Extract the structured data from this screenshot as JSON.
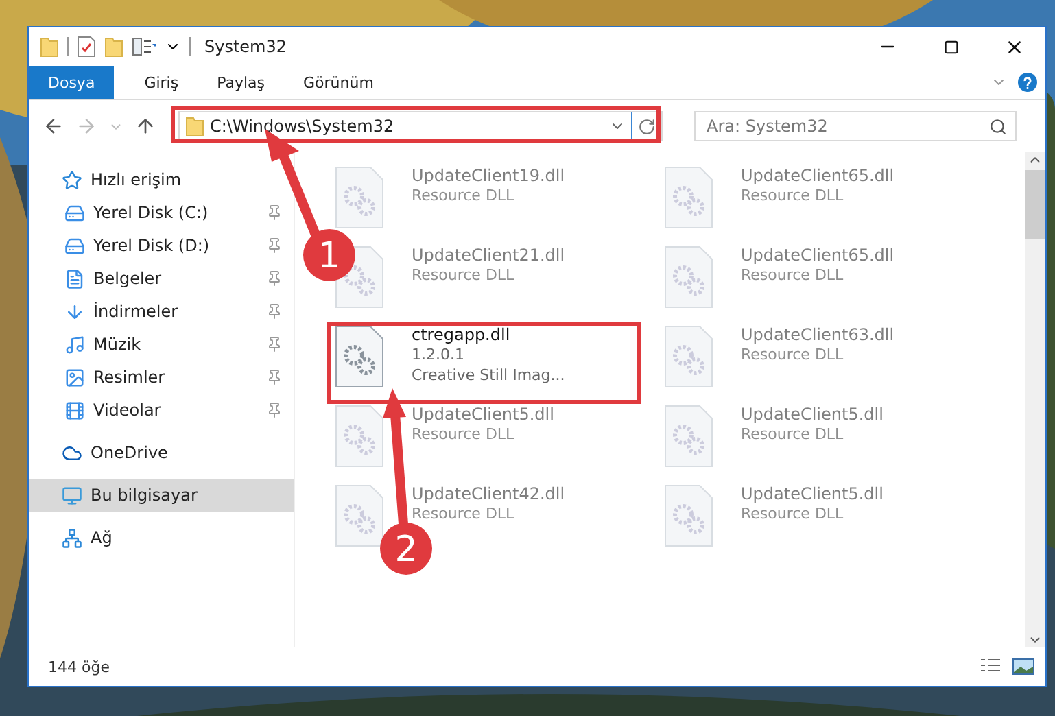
{
  "window": {
    "title": "System32"
  },
  "ribbon_tabs": [
    {
      "label": "Dosya",
      "selected": true
    },
    {
      "label": "Giriş",
      "selected": false
    },
    {
      "label": "Paylaş",
      "selected": false
    },
    {
      "label": "Görünüm",
      "selected": false
    }
  ],
  "address_bar": {
    "value": "C:\\Windows\\System32"
  },
  "search": {
    "placeholder": "Ara: System32"
  },
  "sidebar": {
    "items": [
      {
        "label": "Hızlı erişim",
        "selected": false,
        "children": [
          {
            "label": "Yerel Disk (C:)",
            "pinned": true,
            "selected": false
          },
          {
            "label": "Yerel Disk (D:)",
            "pinned": true,
            "selected": false
          },
          {
            "label": "Belgeler",
            "pinned": true,
            "selected": false
          },
          {
            "label": "İndirmeler",
            "pinned": true,
            "selected": false
          },
          {
            "label": "Müzik",
            "pinned": true,
            "selected": false
          },
          {
            "label": "Resimler",
            "pinned": true,
            "selected": false
          },
          {
            "label": "Videolar",
            "pinned": true,
            "selected": false
          }
        ]
      },
      {
        "label": "OneDrive",
        "selected": false
      },
      {
        "label": "Bu bilgisayar",
        "selected": true
      },
      {
        "label": "Ağ",
        "selected": false
      }
    ]
  },
  "files": [
    {
      "name": "UpdateClient19.dll",
      "details": [
        "Resource DLL"
      ],
      "blurred": true
    },
    {
      "name": "UpdateClient65.dll",
      "details": [
        "Resource DLL"
      ],
      "blurred": true
    },
    {
      "name": "UpdateClient21.dll",
      "details": [
        "Resource DLL"
      ],
      "blurred": true
    },
    {
      "name": "UpdateClient65.dll",
      "details": [
        "Resource DLL"
      ],
      "blurred": true
    },
    {
      "name": "ctregapp.dll",
      "details": [
        "1.2.0.1",
        "Creative Still Imag..."
      ],
      "blurred": false
    },
    {
      "name": "UpdateClient63.dll",
      "details": [
        "Resource DLL"
      ],
      "blurred": true
    },
    {
      "name": "UpdateClient5.dll",
      "details": [
        "Resource DLL"
      ],
      "blurred": true
    },
    {
      "name": "UpdateClient5.dll",
      "details": [
        "Resource DLL"
      ],
      "blurred": true
    },
    {
      "name": "UpdateClient42.dll",
      "details": [
        "Resource DLL"
      ],
      "blurred": true
    },
    {
      "name": "UpdateClient5.dll",
      "details": [
        "Resource DLL"
      ],
      "blurred": true
    }
  ],
  "status_bar": {
    "item_count": "144 öğe"
  },
  "annotations": [
    {
      "label": "1"
    },
    {
      "label": "2"
    }
  ]
}
